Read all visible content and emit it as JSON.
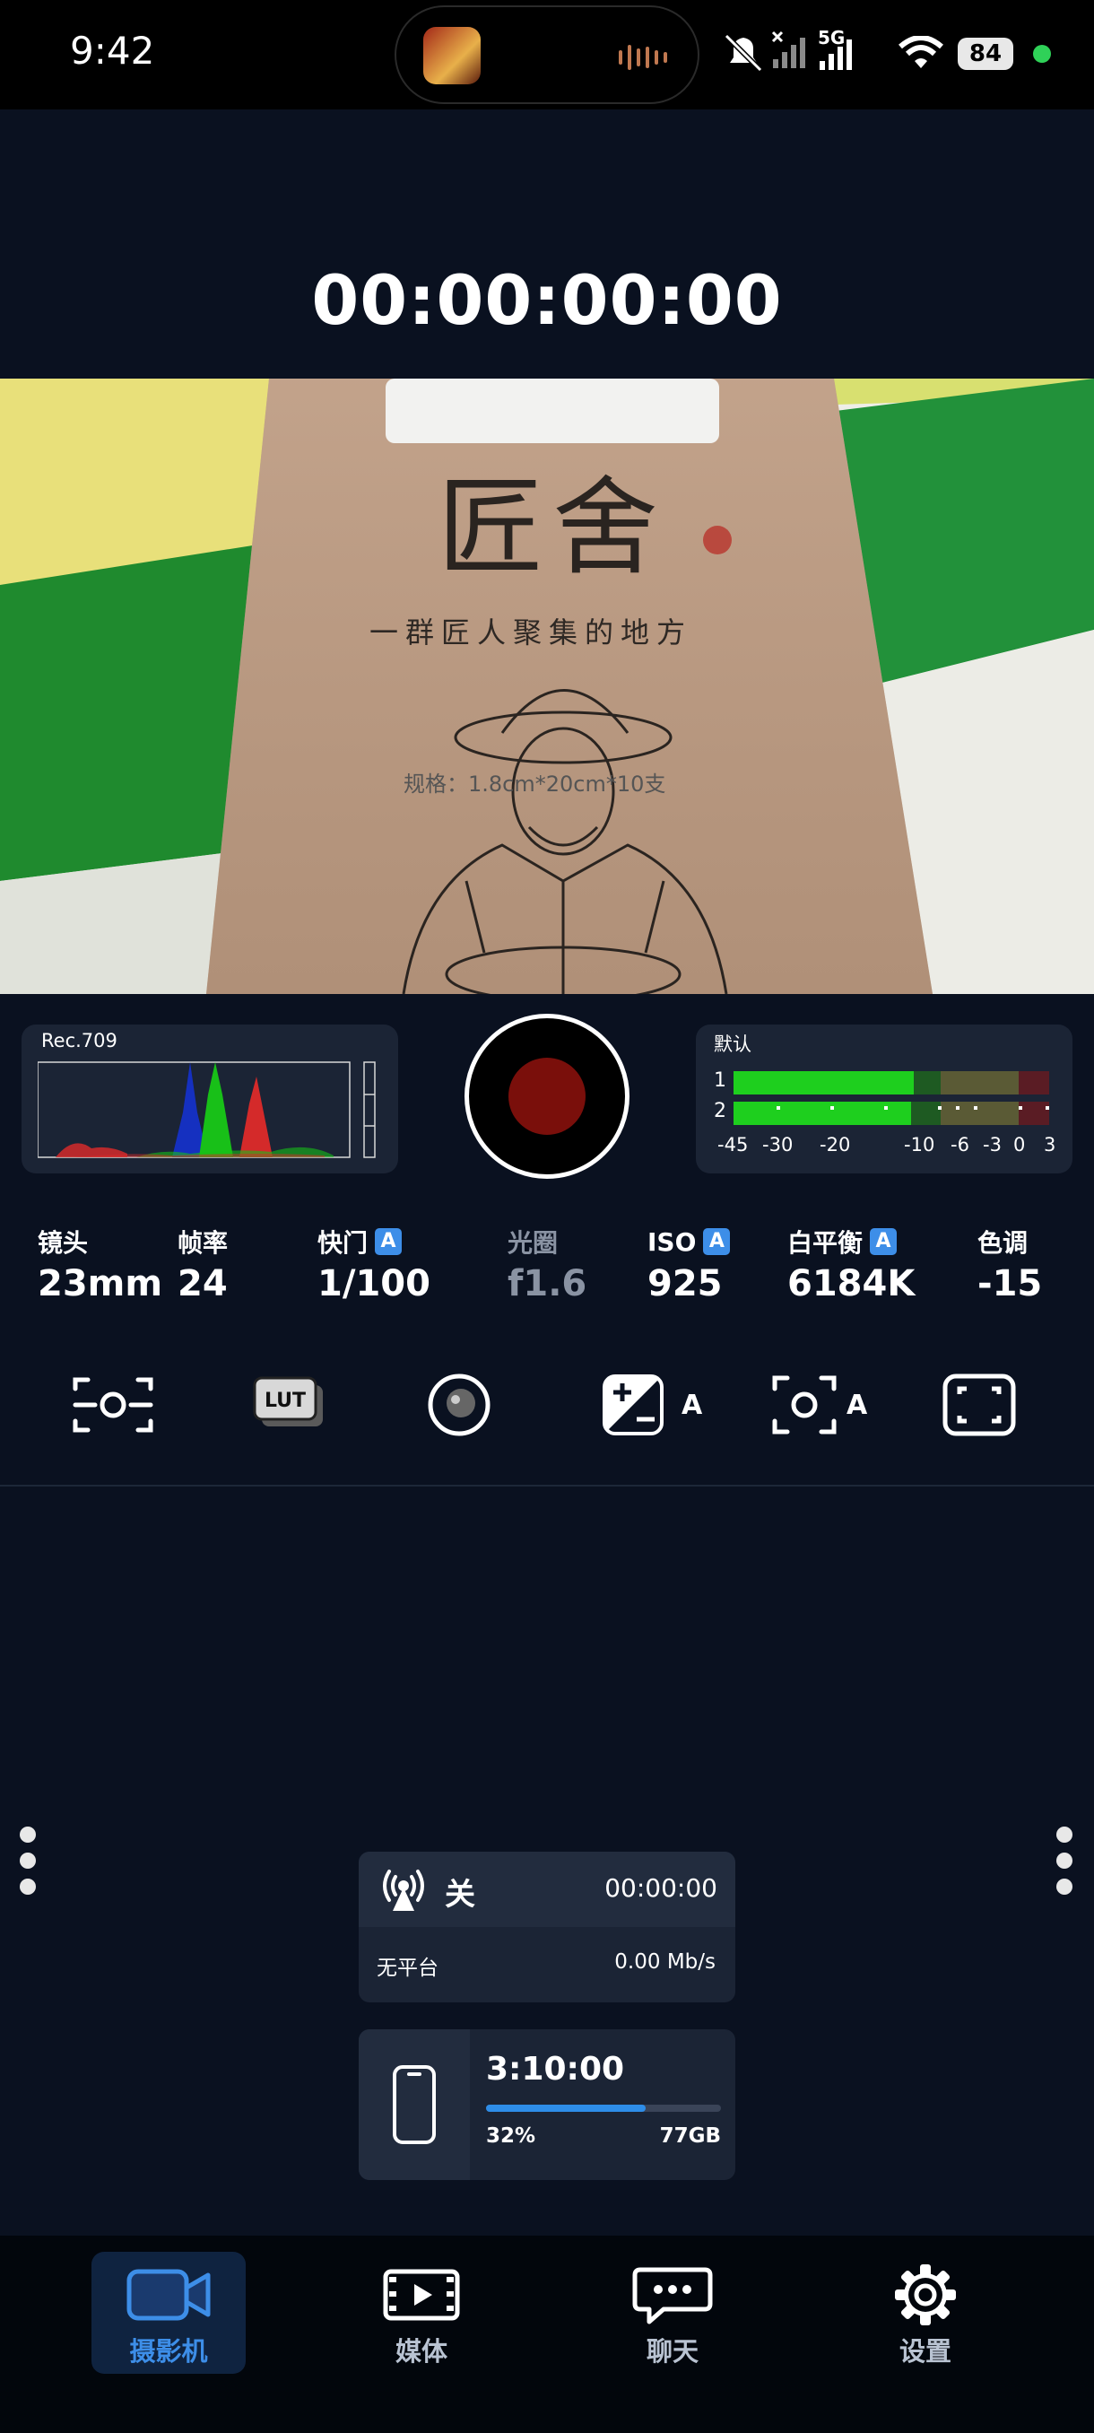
{
  "status_bar": {
    "time": "9:42",
    "network": "5G",
    "battery": "84",
    "icons": [
      "app-thumbnail",
      "audio-wave-icon",
      "mute-icon",
      "signal-icon",
      "signal-icon",
      "wifi-icon",
      "battery-icon",
      "privacy-dot"
    ]
  },
  "timecode": "00:00:00:00",
  "viewfinder": {
    "spec_text": "规格：1.8cm*20cm*10支",
    "brand_text": "匠舍",
    "slogan_text": "一群匠人聚集的地方"
  },
  "histogram": {
    "label": "Rec.709"
  },
  "record_button": {
    "state": "idle"
  },
  "audio_meter": {
    "label": "默认",
    "channels": [
      "1",
      "2"
    ],
    "channel_levels": [
      0.69,
      0.68
    ],
    "scale": [
      "-45",
      "-30",
      "-20",
      "-10",
      "-6",
      "-3",
      "0",
      "3"
    ]
  },
  "params": [
    {
      "label": "镜头",
      "value": "23mm",
      "auto": false,
      "dim": false
    },
    {
      "label": "帧率",
      "value": "24",
      "auto": false,
      "dim": false
    },
    {
      "label": "快门",
      "value": "1/100",
      "auto": true,
      "dim": false
    },
    {
      "label": "光圈",
      "value": "f1.6",
      "auto": false,
      "dim": true
    },
    {
      "label": "ISO",
      "value": "925",
      "auto": true,
      "dim": false
    },
    {
      "label": "白平衡",
      "value": "6184K",
      "auto": true,
      "dim": false
    },
    {
      "label": "色调",
      "value": "-15",
      "auto": false,
      "dim": false
    }
  ],
  "auto_badge": "A",
  "tools": [
    {
      "icon": "focus-icon"
    },
    {
      "icon": "lut-icon",
      "label": "LUT"
    },
    {
      "icon": "lens-icon"
    },
    {
      "icon": "exposure-compensation-icon",
      "suffix": "A"
    },
    {
      "icon": "auto-focus-icon",
      "suffix": "A"
    },
    {
      "icon": "frame-guide-icon"
    }
  ],
  "stream": {
    "status": "关",
    "time": "00:00:00",
    "platform": "无平台",
    "bitrate": "0.00 Mb/s"
  },
  "storage": {
    "remaining_time": "3:10:00",
    "used_percent": "32%",
    "used_fraction": 0.68,
    "capacity": "77GB"
  },
  "nav": [
    {
      "label": "摄影机",
      "icon": "camera-icon",
      "active": true
    },
    {
      "label": "媒体",
      "icon": "media-icon",
      "active": false
    },
    {
      "label": "聊天",
      "icon": "chat-icon",
      "active": false
    },
    {
      "label": "设置",
      "icon": "settings-icon",
      "active": false
    }
  ],
  "colors": {
    "background": "#0a1120",
    "panel": "#1b2435",
    "accent": "#3d8ee8",
    "record": "#7a0f0b",
    "meter_green": "#1ecf1e"
  }
}
